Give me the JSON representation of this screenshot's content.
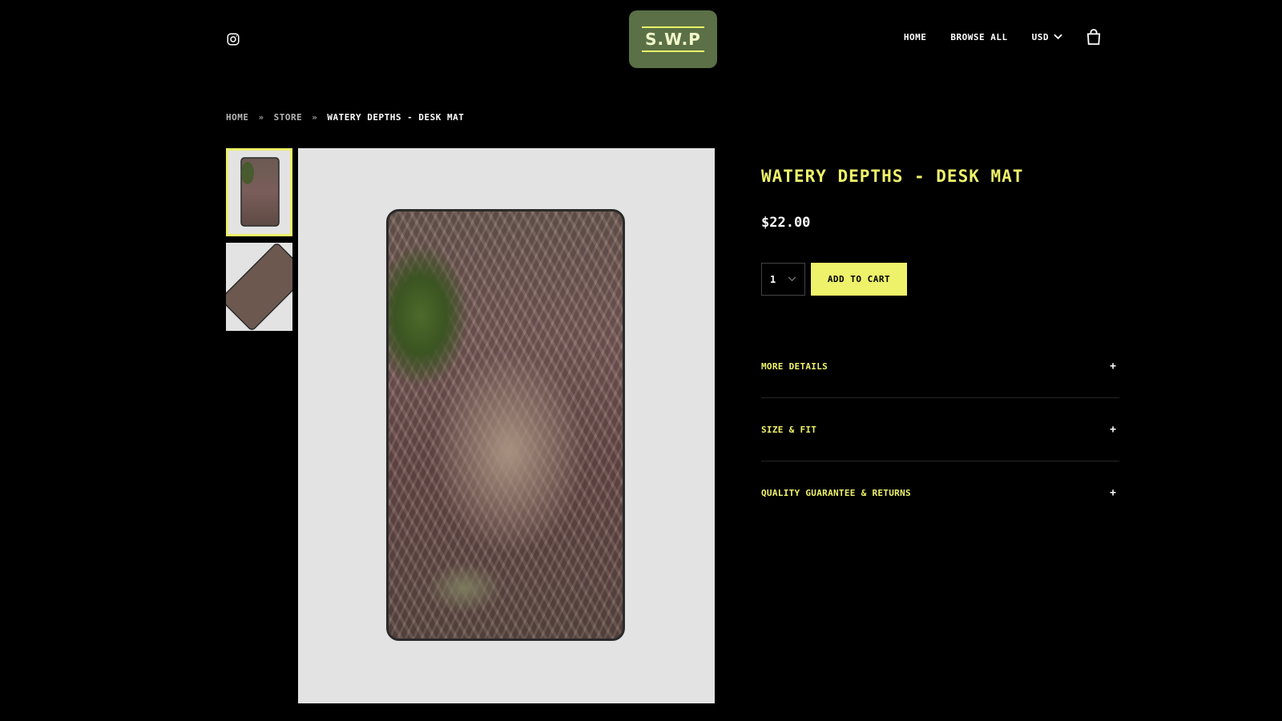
{
  "header": {
    "logo_text": "S.W.P",
    "nav": {
      "home": "HOME",
      "browse_all": "BROWSE ALL",
      "currency": "USD"
    }
  },
  "breadcrumb": {
    "home": "HOME",
    "store": "STORE",
    "separator": "»",
    "current": "WATERY DEPTHS - DESK MAT"
  },
  "product": {
    "title": "WATERY DEPTHS - DESK MAT",
    "price": "$22.00",
    "quantity": "1",
    "add_to_cart_label": "ADD TO CART"
  },
  "accordion": [
    {
      "label": "MORE DETAILS",
      "icon": "+"
    },
    {
      "label": "SIZE & FIT",
      "icon": "+"
    },
    {
      "label": "QUALITY GUARANTEE & RETURNS",
      "icon": "+"
    }
  ],
  "colors": {
    "accent": "#eef26a",
    "logo_bg": "#5b7046",
    "image_bg": "#e3e3e3",
    "background": "#000000"
  },
  "icons": {
    "social": "instagram-icon",
    "cart": "shopping-bag-icon",
    "currency_toggle": "chevron-down-icon",
    "quantity_toggle": "chevron-down-icon"
  }
}
